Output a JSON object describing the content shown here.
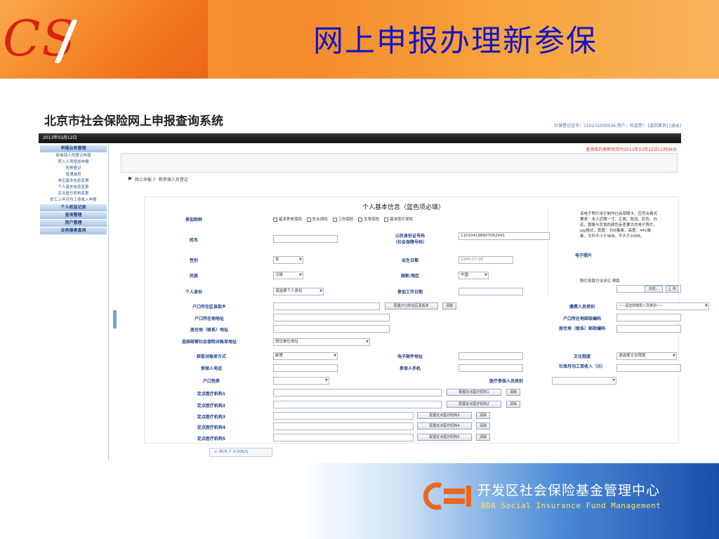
{
  "slide": {
    "title": "网上申报办理新参保",
    "logo_text": "CS",
    "footer_name": "开发区社会保险基金管理中心",
    "footer_en": "BDA Social Insurance Fund Management"
  },
  "app": {
    "title": "北京市社会保险网上申报查询系统",
    "user_bar": "社保登记证号：110231000036 用户，欢迎您！ [返回首页] [退出]",
    "date": "2013年03月12日",
    "notice": "查询库的更新时间为2013年03月12日11时06分",
    "breadcrumb": "网上申报 》 新参保人员登记"
  },
  "nav": {
    "sections": [
      {
        "head": "申报业务管理",
        "items": [
          "新参保人员登记申报",
          "转入人员增加申报",
          "险种登记",
          "普通减员",
          "单位基本信息变更",
          "个人基本信息变更",
          "定点医疗机构变更",
          "职工上年月均工资收入申报"
        ]
      },
      {
        "head": "个人权益记录",
        "items": []
      },
      {
        "head": "查询管理",
        "items": []
      },
      {
        "head": "用户管理",
        "items": []
      },
      {
        "head": "业务报表查询",
        "items": []
      }
    ]
  },
  "form": {
    "caption": "个人基本信息（蓝色项必填）",
    "insurance_label": "参加险种",
    "insurance_options": [
      "基本养老保险",
      "失业保险",
      "工伤保险",
      "生育保险",
      "基本医疗保险"
    ],
    "name_label": "姓名",
    "id_label": "公民身份证号码\n（社会保障号码）",
    "id_value": "110104198607062041",
    "photo_label": "电子照片",
    "photo_note": "该电子照片用于制作社会保障卡，应符合格式要求：本人近期一寸、正面、免冠、彩色、白底，图像与背景的颜色反差要大的电子照片。jpg格式，宽度：358像素，高度：441像素，文件不小于9KB，不大于20KB。",
    "photo_help": "照片剪裁方法详见 帮助",
    "browse_label": "浏览...",
    "upload_label": "上 传",
    "gender_label": "性别",
    "gender_value": "女",
    "birth_label": "出生日期",
    "birth_value": "1986-07-06",
    "nation_label": "民族",
    "nation_value": "汉族",
    "country_label": "国家/地区",
    "country_value": "中国",
    "identity_label": "个人身份",
    "identity_value": "请选择个人身份",
    "work_date_label": "参加工作日期",
    "hukou_district_label": "户口所在区县街乡",
    "hukou_config_btn": "配置户口所在区县街乡",
    "clear_btn": "清除",
    "payer_type_label": "缴费人员类别",
    "payer_type_value": "-----请选择缴费人员类别-----",
    "hukou_address_label": "户口所在地地址",
    "hukou_zip_label": "户口所在地邮政编码",
    "residence_label": "居住地（联系）地址",
    "residence_zip_label": "居住地（联系）邮政编码",
    "mail_label": "选择邮寄社会保险对账单地址",
    "mail_value": "居住单位地址",
    "statement_method_label": "获取对账单方式",
    "statement_method_value": "邮寄",
    "email_label": "电子邮件地址",
    "education_label": "文化程度",
    "education_value": "请选择文化程度",
    "phone_label": "参保人电话",
    "mobile_label": "参保人手机",
    "salary_label": "社保月均工资收入（元）",
    "hukou_nature_label": "户口性质",
    "medical_type_label": "医疗参保人员类别",
    "medical": [
      {
        "label": "定点医疗机构1",
        "btn": "配置定点医疗机构1"
      },
      {
        "label": "定点医疗机构2",
        "btn": "配置定点医疗机构2"
      },
      {
        "label": "定点医疗机构3",
        "btn": "配置定点医疗机构3"
      },
      {
        "label": "定点医疗机构4",
        "btn": "配置定点医疗机构4"
      },
      {
        "label": "定点医疗机构5",
        "btn": "配置定点医疗机构5"
      }
    ]
  },
  "pager": "+ 0K/S ↑ 0.00K/S",
  "colors": {
    "accent": "#1c3f86",
    "title_blue": "#1414c8",
    "orange": "#f58a2c"
  }
}
